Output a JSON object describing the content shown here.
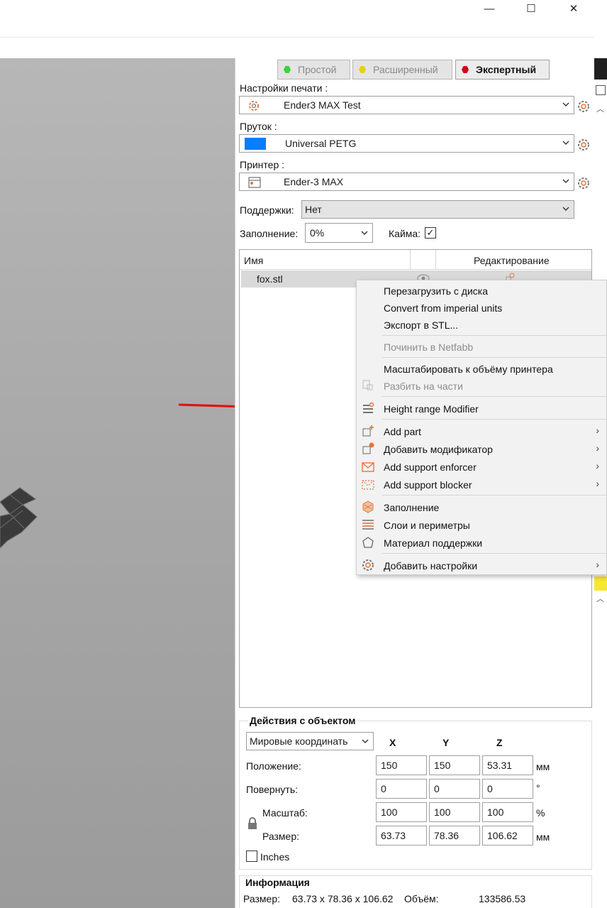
{
  "window": {
    "minimize": "—",
    "maximize": "☐",
    "close": "✕"
  },
  "modes": [
    {
      "label": "Простой",
      "color": "#3ed13e"
    },
    {
      "label": "Расширенный",
      "color": "#e5d214"
    },
    {
      "label": "Экспертный",
      "color": "#d3001c"
    }
  ],
  "print_settings": {
    "label": "Настройки печати :",
    "value": "Ender3 MAX Test"
  },
  "filament": {
    "label": "Пруток :",
    "value": "Universal PETG",
    "swatch": "#0a7cff"
  },
  "printer": {
    "label": "Принтер :",
    "value": "Ender-3 MAX"
  },
  "supports": {
    "label": "Поддержки:",
    "value": "Нет"
  },
  "infill": {
    "label": "Заполнение:",
    "value": "0%"
  },
  "brim": {
    "label": "Кайма:",
    "checked": "✓"
  },
  "object_list": {
    "col_name": "Имя",
    "col_edit": "Редактирование",
    "items": [
      {
        "name": "fox.stl"
      }
    ]
  },
  "context_menu": {
    "items": [
      {
        "label": "Перезагрузить с диска"
      },
      {
        "label": "Convert from imperial units"
      },
      {
        "label": "Экспорт в STL..."
      },
      {
        "label": "Починить в Netfabb"
      },
      {
        "label": "Масштабировать к объёму принтера"
      },
      {
        "label": "Разбить на части"
      },
      {
        "label": "Height range Modifier"
      },
      {
        "label": "Add part"
      },
      {
        "label": "Добавить модификатор"
      },
      {
        "label": "Add support enforcer"
      },
      {
        "label": "Add support blocker"
      },
      {
        "label": "Заполнение"
      },
      {
        "label": "Слои и периметры"
      },
      {
        "label": "Материал поддержки"
      },
      {
        "label": "Добавить настройки"
      }
    ],
    "submenu_glyph": "›"
  },
  "object_actions": {
    "title": "Действия с объектом",
    "coord_system": "Мировые координать",
    "axes": [
      "X",
      "Y",
      "Z"
    ],
    "position": {
      "label": "Положение:",
      "x": "150",
      "y": "150",
      "z": "53.31",
      "unit": "мм"
    },
    "rotate": {
      "label": "Повернуть:",
      "x": "0",
      "y": "0",
      "z": "0",
      "unit": "°"
    },
    "scale": {
      "label": "Масштаб:",
      "x": "100",
      "y": "100",
      "z": "100",
      "unit": "%"
    },
    "size": {
      "label": "Размер:",
      "x": "63.73",
      "y": "78.36",
      "z": "106.62",
      "unit": "мм"
    },
    "inches": "Inches"
  },
  "info": {
    "title": "Информация",
    "size_label": "Размер:",
    "size_value": "63.73 x 78.36 x 106.62",
    "volume_label": "Объём:",
    "volume_value": "133586.53"
  },
  "colors": {
    "accent_orange": "#e8733a",
    "arrow_red": "#e01010"
  }
}
